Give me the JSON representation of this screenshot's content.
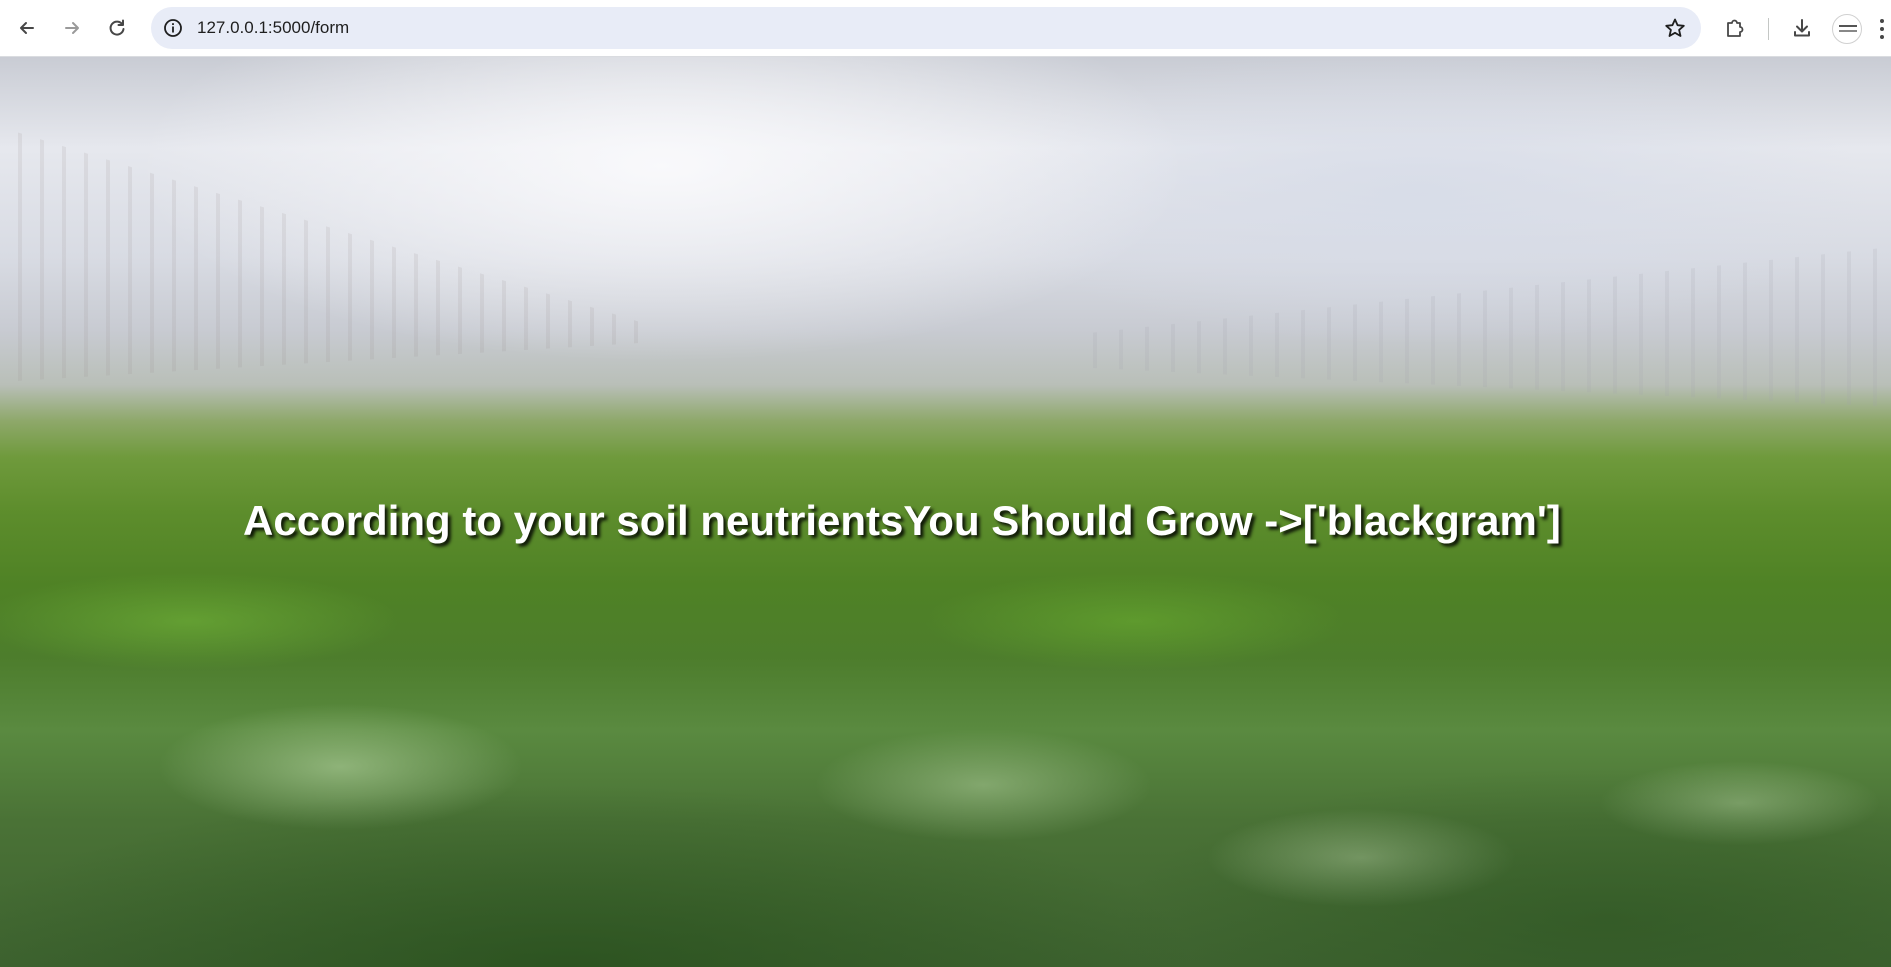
{
  "browser": {
    "url": "127.0.0.1:5000/form"
  },
  "page": {
    "result_prefix": "According to your soil neutrients",
    "result_middle": "You Should Grow ->",
    "result_value": "['blackgram']"
  },
  "colors": {
    "toolbar_bg": "#ffffff",
    "omnibox_bg": "#e8ecf7",
    "result_text": "#ffffff"
  },
  "icons": {
    "back": "back-arrow-icon",
    "forward": "forward-arrow-icon",
    "reload": "reload-icon",
    "site_info": "info-icon",
    "bookmark": "star-icon",
    "extensions": "puzzle-icon",
    "downloads": "download-icon",
    "profile": "avatar",
    "menu": "kebab-menu-icon"
  }
}
